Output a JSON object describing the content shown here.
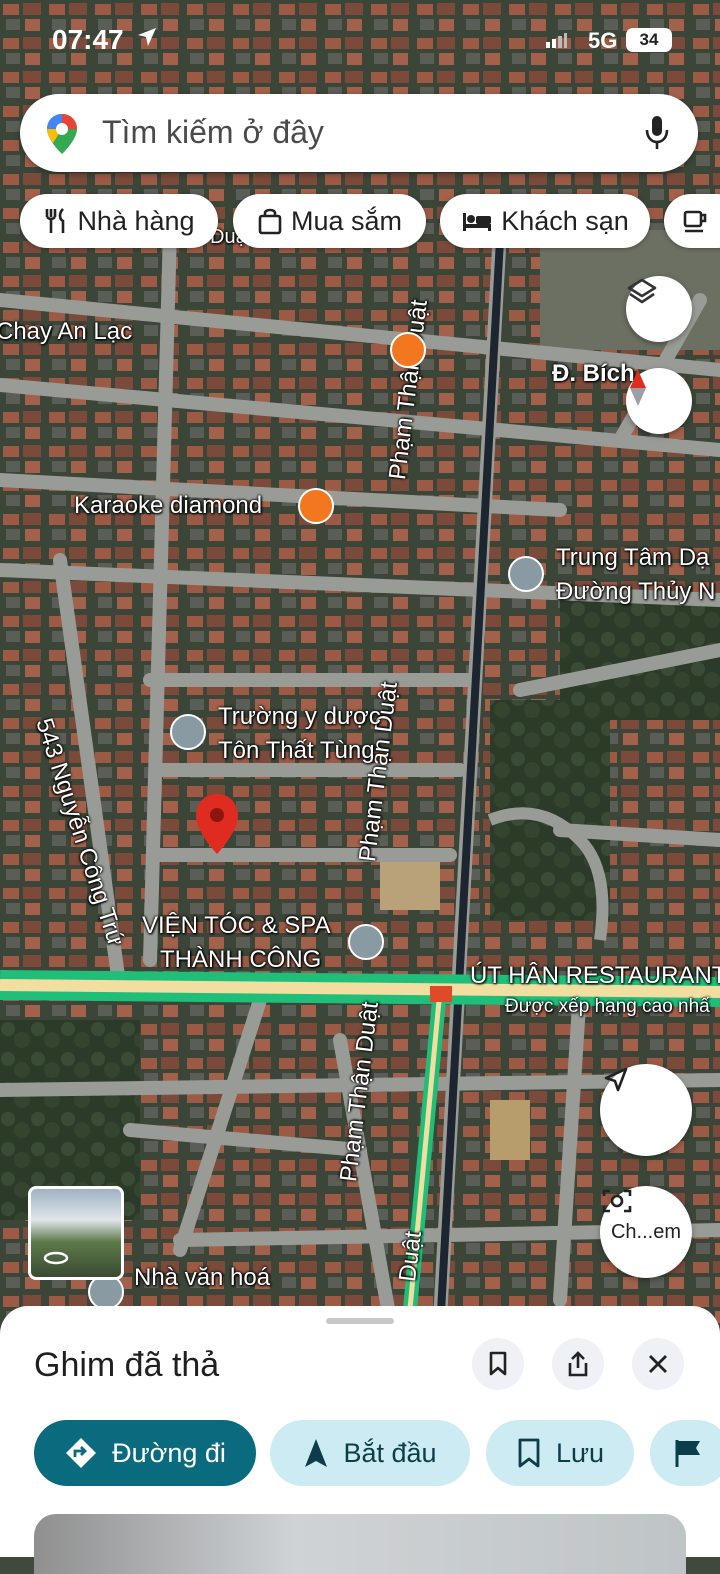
{
  "status_bar": {
    "time": "07:47",
    "network": "5G",
    "battery": "34"
  },
  "search": {
    "placeholder": "Tìm kiếm ở đây"
  },
  "chips": [
    {
      "label": "Nhà hàng",
      "icon": "restaurant-icon"
    },
    {
      "label": "Mua sắm",
      "icon": "shopping-bag-icon"
    },
    {
      "label": "Khách sạn",
      "icon": "bed-icon"
    },
    {
      "label": "",
      "icon": "coffee-icon"
    }
  ],
  "map": {
    "street_labels": {
      "chay_an_lac": "Chay An Lạc",
      "bich": "Đ. Bích",
      "pham_than_duat_1": "Phạm Thận Duật",
      "pham_than_duat_2": "Phạm Thận Duật",
      "pham_than_duat_3": "Phạm Thận Duật",
      "duat_top": "Duật",
      "duat_bottom": "Duật",
      "nguyen_cong_tru": "543 Nguyễn Công Trứ"
    },
    "places": {
      "karaoke": "Karaoke diamond",
      "trung_tam_line1": "Trung Tâm Dạ",
      "trung_tam_line2": "Đường Thủy N",
      "truong_line1": "Trường y dược",
      "truong_line2": "Tôn Thất Tùng",
      "vien_toc_line1": "VIỆN TÓC & SPA",
      "vien_toc_line2": "THÀNH CÔNG",
      "ut_han": "ÚT HÂN RESTAURANT",
      "ut_han_sub": "Được xếp hạng cao nhấ",
      "nha_van_hoa": "Nhà văn hoá"
    },
    "lens_label": "Ch...em",
    "colors": {
      "road": "#9a9c97",
      "traffic_green": "#1fbf7a",
      "pin_red": "#e02b20",
      "poi_orange": "#f2771f",
      "poi_grey": "#8a9aa3"
    }
  },
  "sheet": {
    "title": "Ghim đã thả",
    "actions": [
      {
        "label": "Đường đi",
        "icon": "directions-icon"
      },
      {
        "label": "Bắt đầu",
        "icon": "navigation-arrow-icon"
      },
      {
        "label": "Lưu",
        "icon": "bookmark-icon"
      },
      {
        "label": "",
        "icon": "flag-icon"
      }
    ]
  }
}
